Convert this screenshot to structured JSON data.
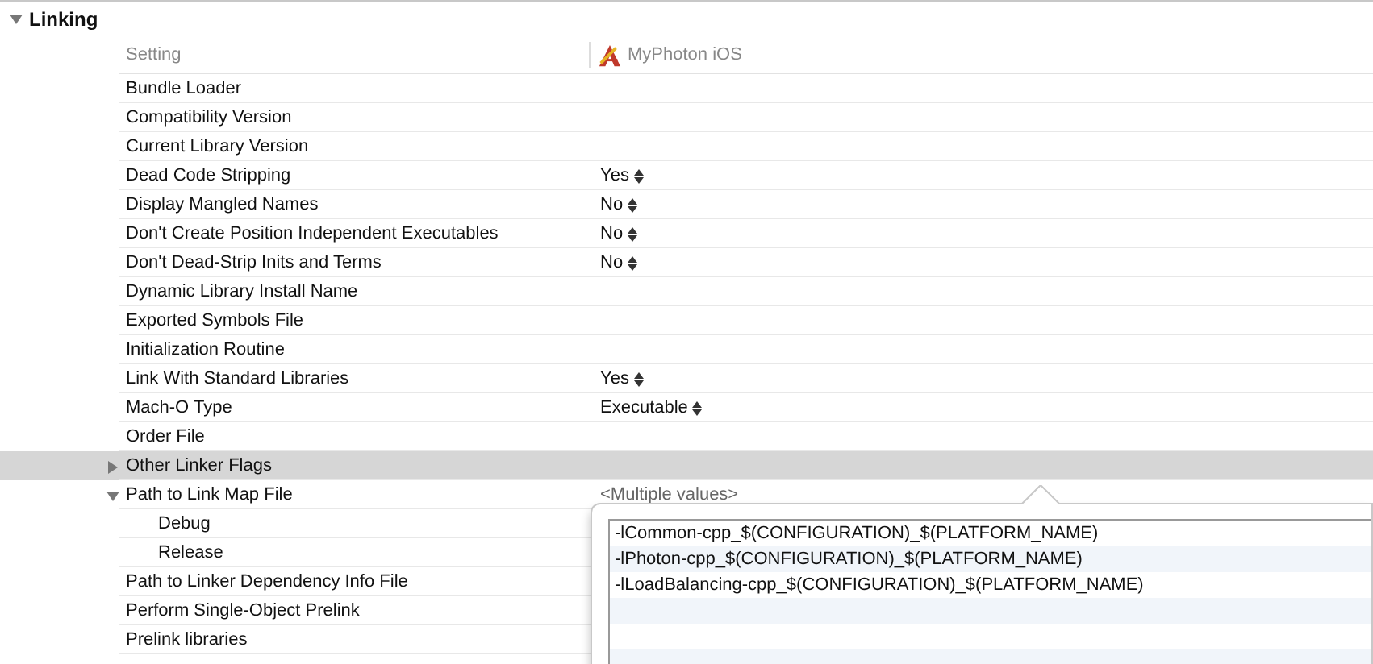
{
  "section": {
    "title": "Linking",
    "expanded": true
  },
  "header": {
    "setting": "Setting",
    "target": "MyPhoton iOS"
  },
  "rows": [
    {
      "name": "Bundle Loader",
      "selected": false
    },
    {
      "name": "Compatibility Version",
      "selected": false
    },
    {
      "name": "Current Library Version",
      "selected": false
    },
    {
      "name": "Dead Code Stripping",
      "value": "Yes",
      "kind": "popup",
      "selected": false
    },
    {
      "name": "Display Mangled Names",
      "value": "No",
      "kind": "popup",
      "selected": false
    },
    {
      "name": "Don't Create Position Independent Executables",
      "value": "No",
      "kind": "popup",
      "selected": false
    },
    {
      "name": "Don't Dead-Strip Inits and Terms",
      "value": "No",
      "kind": "popup",
      "selected": false
    },
    {
      "name": "Dynamic Library Install Name",
      "selected": false
    },
    {
      "name": "Exported Symbols File",
      "selected": false
    },
    {
      "name": "Initialization Routine",
      "selected": false
    },
    {
      "name": "Link With Standard Libraries",
      "value": "Yes",
      "kind": "popup",
      "selected": false
    },
    {
      "name": "Mach-O Type",
      "value": "Executable",
      "kind": "popup",
      "selected": false
    },
    {
      "name": "Order File",
      "selected": false
    },
    {
      "name": "Other Linker Flags",
      "expanded": false,
      "selected": true
    },
    {
      "name": "Path to Link Map File",
      "value": "<Multiple values>",
      "kind": "text",
      "expanded": true,
      "selected": false,
      "children": [
        {
          "name": "Debug",
          "selected": false
        },
        {
          "name": "Release",
          "selected": false
        }
      ]
    },
    {
      "name": "Path to Linker Dependency Info File",
      "selected": false
    },
    {
      "name": "Perform Single-Object Prelink",
      "selected": false
    },
    {
      "name": "Prelink libraries",
      "selected": false
    }
  ],
  "popover": {
    "lines": [
      "-lCommon-cpp_$(CONFIGURATION)_$(PLATFORM_NAME)",
      "-lPhoton-cpp_$(CONFIGURATION)_$(PLATFORM_NAME)",
      "-lLoadBalancing-cpp_$(CONFIGURATION)_$(PLATFORM_NAME)"
    ]
  }
}
